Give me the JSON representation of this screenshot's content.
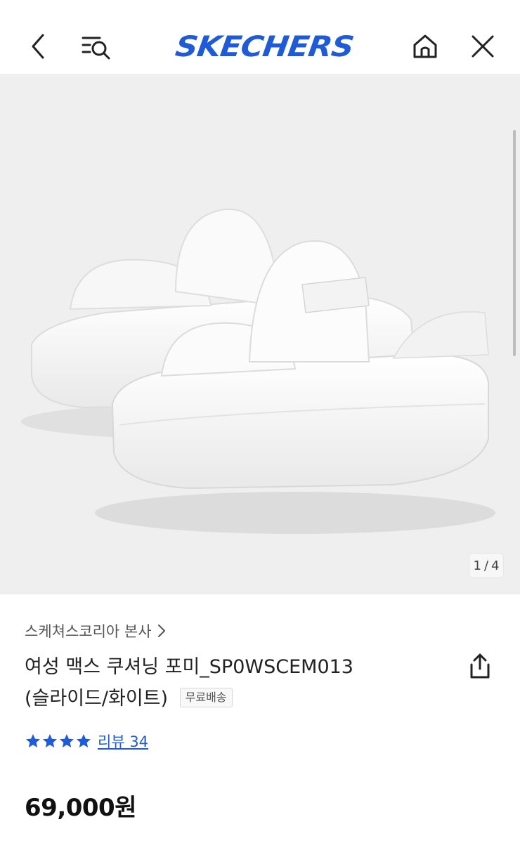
{
  "header": {
    "brand_logo": "SKECHERS",
    "brand_color": "#1f5bd6",
    "icons": [
      "back-arrow-icon",
      "search-list-icon",
      "home-icon",
      "close-icon"
    ]
  },
  "gallery": {
    "current": "1",
    "total": "4",
    "separator": "/",
    "background": "#efefef"
  },
  "product": {
    "seller": "스케쳐스코리아 본사",
    "title_line1": "여성 맥스 쿠셔닝 포미_SP0WSCEM013",
    "title_line2": "(슬라이드/화이트)",
    "badge": "무료배송",
    "rating_stars": 4,
    "reviews_label": "리뷰 34",
    "price": "69,000원"
  }
}
